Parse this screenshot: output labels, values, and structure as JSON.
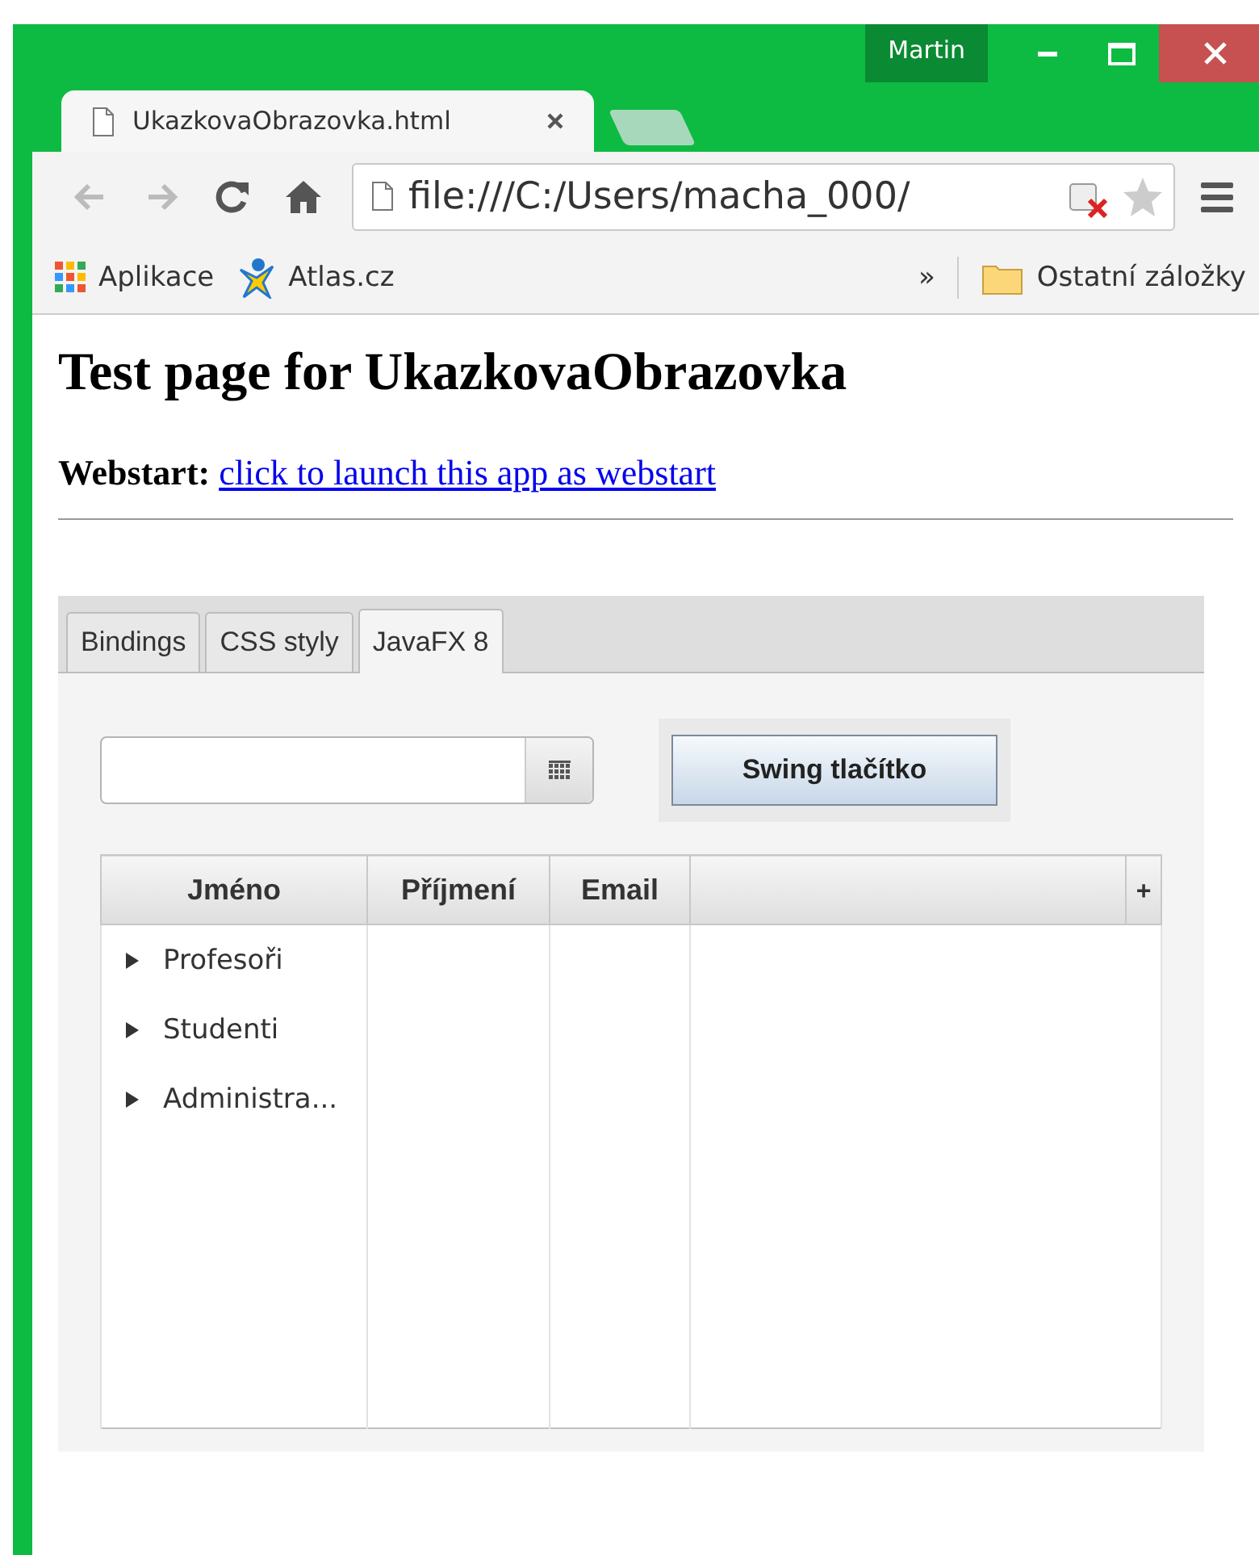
{
  "window": {
    "profile": "Martin"
  },
  "browser_tabs": [
    {
      "title": "UkazkovaObrazovka.html",
      "selected": true
    }
  ],
  "toolbar": {
    "back_disabled": true,
    "forward_disabled": true,
    "address": "file:///C:/Users/macha_000/"
  },
  "bookmarks": [
    {
      "label": "Aplikace",
      "kind": "apps"
    },
    {
      "label": "Atlas.cz",
      "kind": "site"
    }
  ],
  "bookmarks_overflow": "»",
  "other_bookmarks": "Ostatní záložky",
  "page": {
    "heading": "Test page for UkazkovaObrazovka",
    "webstart_label": "Webstart:",
    "webstart_link": "click to launch this app as webstart"
  },
  "app": {
    "tabs": [
      {
        "label": "Bindings",
        "selected": false
      },
      {
        "label": "CSS styly",
        "selected": false
      },
      {
        "label": "JavaFX 8",
        "selected": true
      }
    ],
    "button": "Swing tlačítko",
    "table": {
      "columns": [
        "Jméno",
        "Příjmení",
        "Email"
      ],
      "menu_button": "+",
      "rows": [
        {
          "label": "Profesoři",
          "expanded": false
        },
        {
          "label": "Studenti",
          "expanded": false
        },
        {
          "label": "Administra...",
          "expanded": false
        }
      ]
    }
  }
}
